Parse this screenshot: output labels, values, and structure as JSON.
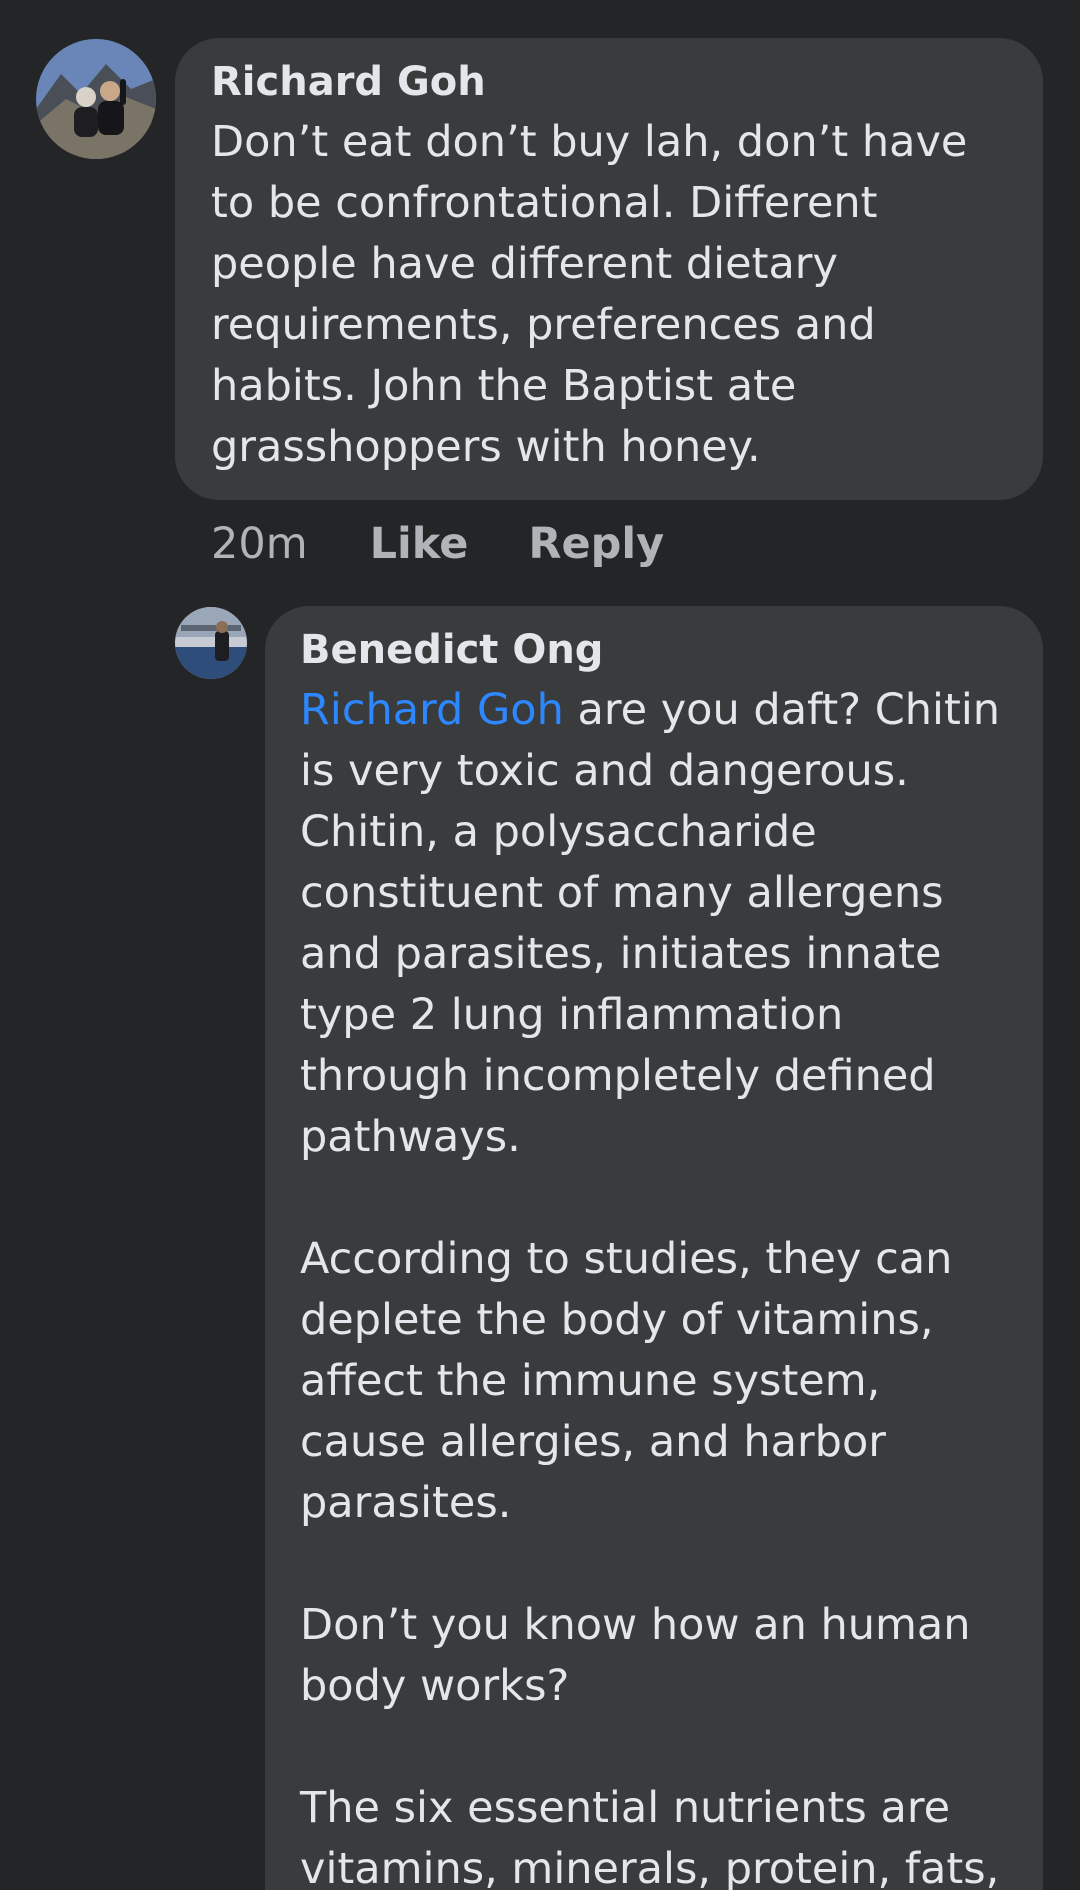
{
  "comments": [
    {
      "author": "Richard Goh",
      "paragraphs": [
        "Don’t eat don’t buy lah, don’t have to be confrontational. Different people have different dietary requirements, preferences and habits. John the Baptist ate grasshoppers with honey."
      ],
      "time": "20m",
      "like_label": "Like",
      "reply_label": "Reply"
    },
    {
      "author": "Benedict Ong",
      "mention": "Richard Goh",
      "paragraphs": [
        " are you daft? Chitin is very toxic and dangerous. Chitin, a polysaccharide constituent of many allergens and parasites, initiates innate type 2 lung inflammation through incompletely defined pathways.",
        "According to studies, they can deplete the body of vitamins, affect the immune system, cause allergies, and harbor parasites.",
        "Don’t you know how an human body works?",
        "The six essential nutrients are vitamins, minerals, protein, fats,"
      ]
    }
  ],
  "colors": {
    "background": "#242526",
    "bubble": "#3a3b3c",
    "text": "#e4e6eb",
    "secondary_text": "#b0b3b8",
    "mention": "#2d88ff"
  }
}
